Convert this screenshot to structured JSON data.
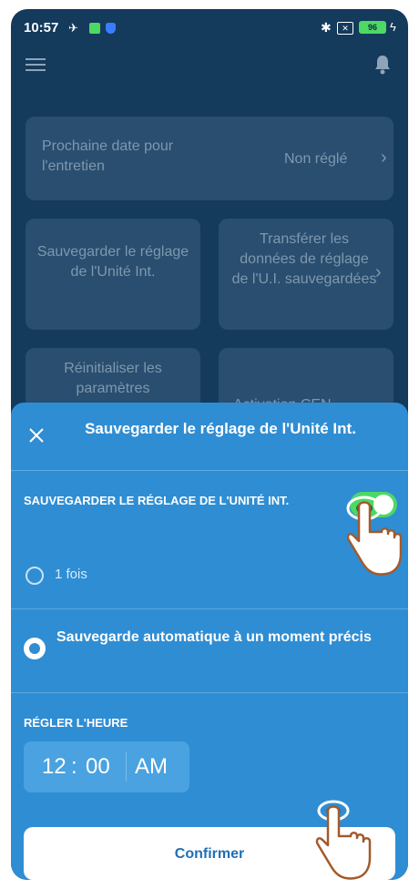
{
  "status_bar": {
    "time": "10:57",
    "battery": "96"
  },
  "background": {
    "maintenance_label": "Prochaine date pour l'entretien",
    "maintenance_value": "Non réglé",
    "save_setting_label": "Sauvegarder le réglage de l'Unité Int.",
    "transfer_label": "Transférer les données de réglage de l'U.I. sauvegardées",
    "reset_label": "Réinitialiser les paramètres",
    "auto_label": "Activation CEN"
  },
  "sheet": {
    "title": "Sauvegarder le réglage de l'Unité Int.",
    "section_save": "SAUVEGARDER LE RÉGLAGE DE L'UNITÉ INT.",
    "toggle_on": true,
    "option_once": "1 fois",
    "option_auto": "Sauvegarde automatique à un moment précis",
    "selected_option": "option_auto",
    "section_time": "RÉGLER L'HEURE",
    "time_hour": "12",
    "time_separator": ":",
    "time_minute": "00",
    "time_ampm": "AM",
    "confirm_label": "Confirmer"
  },
  "colors": {
    "screen_background": "#143a5c",
    "card_background": "#294e70",
    "sheet_background": "#2f8dd3",
    "toggle_on": "#4cd964",
    "confirm_text": "#1f6fb5"
  },
  "icons": [
    "hamburger-menu-icon",
    "bell-icon",
    "close-icon",
    "chevron-right-icon",
    "pointing-hand-icon"
  ]
}
